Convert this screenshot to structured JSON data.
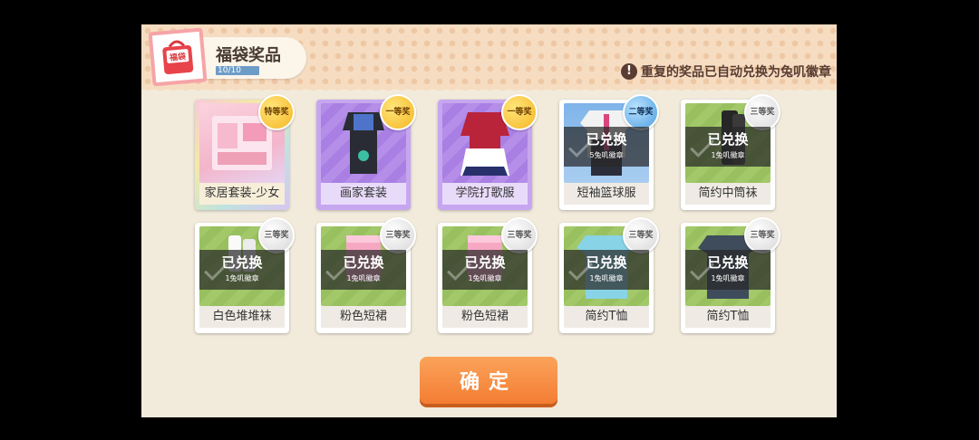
{
  "header": {
    "title": "福袋奖品",
    "progress_text": "10/10",
    "progress": 1.0,
    "notice": "重复的奖品已自动兑换为兔叽徽章",
    "bag_label": "福袋"
  },
  "prizes": [
    {
      "name": "家居套装-少女",
      "tier": "特等奖",
      "redeemed": false
    },
    {
      "name": "画家套装",
      "tier": "一等奖",
      "redeemed": false
    },
    {
      "name": "学院打歌服",
      "tier": "一等奖",
      "redeemed": false
    },
    {
      "name": "短袖篮球服",
      "tier": "二等奖",
      "redeemed": true,
      "redeem_title": "已兑换",
      "redeem_value": "5兔叽徽章"
    },
    {
      "name": "简约中筒袜",
      "tier": "三等奖",
      "redeemed": true,
      "redeem_title": "已兑换",
      "redeem_value": "1兔叽徽章"
    },
    {
      "name": "白色堆堆袜",
      "tier": "三等奖",
      "redeemed": true,
      "redeem_title": "已兑换",
      "redeem_value": "1兔叽徽章"
    },
    {
      "name": "粉色短裙",
      "tier": "三等奖",
      "redeemed": true,
      "redeem_title": "已兑换",
      "redeem_value": "1兔叽徽章"
    },
    {
      "name": "粉色短裙",
      "tier": "三等奖",
      "redeemed": true,
      "redeem_title": "已兑换",
      "redeem_value": "1兔叽徽章"
    },
    {
      "name": "简约T恤",
      "tier": "三等奖",
      "redeemed": true,
      "redeem_title": "已兑换",
      "redeem_value": "1兔叽徽章"
    },
    {
      "name": "简约T恤",
      "tier": "三等奖",
      "redeemed": true,
      "redeem_title": "已兑换",
      "redeem_value": "1兔叽徽章"
    }
  ],
  "confirm_label": "确定",
  "colors": {
    "accent": "#f37d33",
    "tier_gold": "#f5b623",
    "tier_blue": "#4f9ee0",
    "tier_gray": "#d7d7d7"
  }
}
